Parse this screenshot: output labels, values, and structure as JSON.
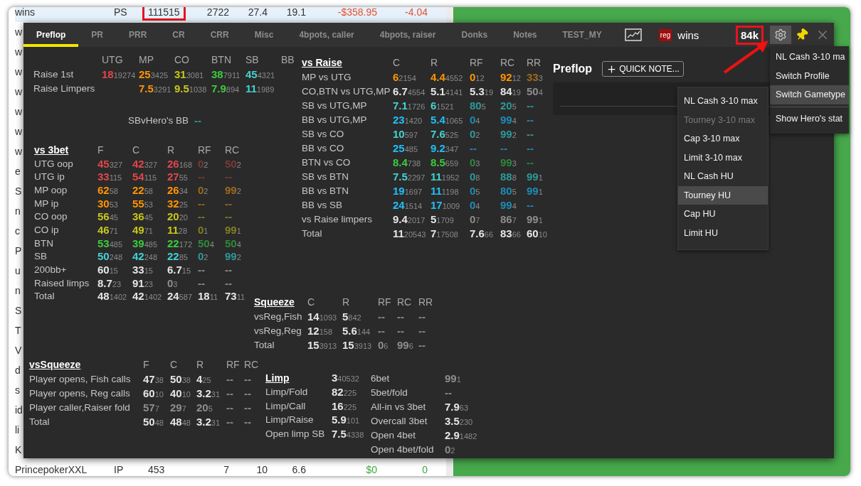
{
  "background_table": {
    "rows": [
      {
        "selected": true,
        "color": "#e8502e",
        "cells": [
          {
            "text": "wins",
            "boxed": false
          },
          {
            "text": "PS",
            "boxed": false
          },
          {
            "text": "111515",
            "boxed": true
          },
          {
            "text": "2722",
            "boxed": false
          },
          {
            "text": "27.4",
            "boxed": false
          },
          {
            "text": "19.1",
            "boxed": false
          },
          {
            "text": "-$358.95",
            "boxed": false
          },
          {
            "text": "-4.04",
            "boxed": false
          }
        ]
      },
      {
        "selected": false,
        "cells": [
          {
            "text": "w",
            "boxed": false
          }
        ]
      },
      {
        "selected": false,
        "cells": [
          {
            "text": "w",
            "boxed": false
          }
        ]
      },
      {
        "selected": false,
        "cells": [
          {
            "text": "w",
            "boxed": false
          }
        ]
      },
      {
        "selected": false,
        "cells": [
          {
            "text": "w",
            "boxed": false
          }
        ]
      },
      {
        "selected": false,
        "cells": [
          {
            "text": "w",
            "boxed": false
          }
        ]
      },
      {
        "selected": false,
        "cells": [
          {
            "text": "w",
            "boxed": false
          }
        ]
      },
      {
        "selected": false,
        "cells": [
          {
            "text": "w",
            "boxed": false
          }
        ]
      },
      {
        "selected": false,
        "cells": [
          {
            "text": "e",
            "boxed": false
          }
        ]
      },
      {
        "selected": false,
        "cells": [
          {
            "text": "S",
            "boxed": false
          }
        ]
      },
      {
        "selected": false,
        "cells": [
          {
            "text": "n",
            "boxed": false
          }
        ]
      },
      {
        "selected": false,
        "cells": [
          {
            "text": "c",
            "boxed": false
          }
        ]
      },
      {
        "selected": false,
        "cells": [
          {
            "text": "P",
            "boxed": false
          }
        ]
      },
      {
        "selected": false,
        "cells": [
          {
            "text": "u",
            "boxed": false
          }
        ]
      },
      {
        "selected": false,
        "cells": [
          {
            "text": "n",
            "boxed": false
          }
        ]
      },
      {
        "selected": false,
        "cells": [
          {
            "text": "S",
            "boxed": false
          }
        ]
      },
      {
        "selected": false,
        "cells": [
          {
            "text": "T",
            "boxed": false
          }
        ]
      },
      {
        "selected": false,
        "cells": [
          {
            "text": "V",
            "boxed": false
          }
        ]
      },
      {
        "selected": false,
        "cells": [
          {
            "text": "d",
            "boxed": false
          }
        ]
      },
      {
        "selected": false,
        "cells": [
          {
            "text": "s",
            "boxed": false
          }
        ]
      },
      {
        "selected": false,
        "cells": [
          {
            "text": "id",
            "boxed": false
          }
        ]
      },
      {
        "selected": false,
        "cells": [
          {
            "text": "li",
            "boxed": false
          }
        ]
      },
      {
        "selected": false,
        "cells": [
          {
            "text": "K",
            "boxed": false
          }
        ]
      },
      {
        "selected": false,
        "color": "#3caa3c",
        "cells": [
          {
            "text": "PrincepokerXXL",
            "boxed": false
          },
          {
            "text": "IP",
            "boxed": false
          },
          {
            "text": "453",
            "boxed": false
          },
          {
            "text": "7",
            "boxed": false
          },
          {
            "text": "10",
            "boxed": false
          },
          {
            "text": "6.6",
            "boxed": false
          },
          {
            "text": "$0",
            "boxed": false
          },
          {
            "text": "0",
            "boxed": false
          }
        ]
      }
    ]
  },
  "popup": {
    "tabs": [
      {
        "label": "Preflop",
        "selected": true
      },
      {
        "label": "PR",
        "selected": false
      },
      {
        "label": "PRR",
        "selected": false
      },
      {
        "label": "CR",
        "selected": false
      },
      {
        "label": "CRR",
        "selected": false
      },
      {
        "label": "Misc",
        "selected": false
      },
      {
        "label": "4bpots, caller",
        "selected": false
      },
      {
        "label": "4bpots, raiser",
        "selected": false
      },
      {
        "label": "Donks",
        "selected": false
      },
      {
        "label": "Notes",
        "selected": false
      },
      {
        "label": "TEST_MY",
        "selected": false
      }
    ],
    "player": {
      "type_badge": "reg",
      "name": "wins",
      "hands": "84k",
      "hands_boxed": true
    },
    "stats": {
      "positions": {
        "columns": [
          "UTG",
          "MP",
          "CO",
          "BTN",
          "SB",
          "BB"
        ],
        "rows": [
          {
            "label": "Raise 1st",
            "cells": [
              {
                "v": "18",
                "n": "19274",
                "color": "#e0474c"
              },
              {
                "v": "25",
                "n": "3425",
                "color": "#ff9500"
              },
              {
                "v": "31",
                "n": "3081",
                "color": "#c8c81a"
              },
              {
                "v": "38",
                "n": "7911",
                "color": "#3ccc3c"
              },
              {
                "v": "45",
                "n": "4321",
                "color": "#45d2d2"
              },
              null
            ]
          },
          {
            "label": "Raise Limpers",
            "cells": [
              null,
              {
                "v": "7.5",
                "n": "3291",
                "color": "#ff9500"
              },
              {
                "v": "9.5",
                "n": "1038",
                "color": "#c8c81a"
              },
              {
                "v": "7.9",
                "n": "894",
                "color": "#3ccc3c"
              },
              {
                "v": "11",
                "n": "1989",
                "color": "#45d2d2"
              },
              null
            ]
          }
        ]
      },
      "sb_vs_hero": {
        "label": "SBvHero's BB",
        "value": {
          "v": "--",
          "color": "#2e9a9a"
        }
      },
      "vs_3bet": {
        "title": "vs 3bet",
        "columns": [
          "F",
          "C",
          "R",
          "RF",
          "RC"
        ],
        "rows": [
          {
            "label": "UTG oop",
            "cells": [
              {
                "v": "45",
                "n": "327",
                "color": "#e0474c"
              },
              {
                "v": "42",
                "n": "327",
                "color": "#e0474c"
              },
              {
                "v": "26",
                "n": "168",
                "color": "#e0474c"
              },
              {
                "v": "0",
                "n": "2",
                "color": "#7a3a3a"
              },
              {
                "v": "50",
                "n": "2",
                "color": "#7a3a3a"
              }
            ]
          },
          {
            "label": "UTG ip",
            "cells": [
              {
                "v": "33",
                "n": "115",
                "color": "#e0474c"
              },
              {
                "v": "54",
                "n": "115",
                "color": "#e0474c"
              },
              {
                "v": "27",
                "n": "55",
                "color": "#e0474c"
              },
              {
                "v": "--",
                "color": "#7a3a3a"
              },
              {
                "v": "--",
                "color": "#7a3a3a"
              }
            ]
          },
          {
            "label": "MP oop",
            "cells": [
              {
                "v": "62",
                "n": "58",
                "color": "#ff9500"
              },
              {
                "v": "22",
                "n": "58",
                "color": "#ff9500"
              },
              {
                "v": "26",
                "n": "34",
                "color": "#ff9500"
              },
              {
                "v": "0",
                "n": "2",
                "color": "#a0691c"
              },
              {
                "v": "99",
                "n": "2",
                "color": "#a0691c"
              }
            ]
          },
          {
            "label": "MP ip",
            "cells": [
              {
                "v": "30",
                "n": "53",
                "color": "#ff9500"
              },
              {
                "v": "55",
                "n": "53",
                "color": "#ff9500"
              },
              {
                "v": "32",
                "n": "25",
                "color": "#ff9500"
              },
              {
                "v": "--",
                "color": "#a0691c"
              },
              {
                "v": "--",
                "color": "#a0691c"
              }
            ]
          },
          {
            "label": "CO oop",
            "cells": [
              {
                "v": "56",
                "n": "45",
                "color": "#c8c81a"
              },
              {
                "v": "36",
                "n": "45",
                "color": "#c8c81a"
              },
              {
                "v": "20",
                "n": "20",
                "color": "#c8c81a"
              },
              {
                "v": "--",
                "color": "#80801c"
              },
              {
                "v": "--",
                "color": "#80801c"
              }
            ]
          },
          {
            "label": "CO ip",
            "cells": [
              {
                "v": "46",
                "n": "71",
                "color": "#c8c81a"
              },
              {
                "v": "49",
                "n": "71",
                "color": "#c8c81a"
              },
              {
                "v": "11",
                "n": "28",
                "color": "#c8c81a"
              },
              {
                "v": "0",
                "n": "1",
                "color": "#80801c"
              },
              {
                "v": "99",
                "n": "1",
                "color": "#80801c"
              }
            ]
          },
          {
            "label": "BTN",
            "cells": [
              {
                "v": "53",
                "n": "485",
                "color": "#3ccc3c"
              },
              {
                "v": "39",
                "n": "485",
                "color": "#3ccc3c"
              },
              {
                "v": "22",
                "n": "172",
                "color": "#3ccc3c"
              },
              {
                "v": "50",
                "n": "4",
                "color": "#2e8a3a"
              },
              {
                "v": "50",
                "n": "4",
                "color": "#2e8a3a"
              }
            ]
          },
          {
            "label": "SB",
            "cells": [
              {
                "v": "50",
                "n": "248",
                "color": "#45d2d2"
              },
              {
                "v": "42",
                "n": "248",
                "color": "#45d2d2"
              },
              {
                "v": "22",
                "n": "85",
                "color": "#45d2d2"
              },
              {
                "v": "0",
                "n": "2",
                "color": "#2e9a9a"
              },
              {
                "v": "99",
                "n": "2",
                "color": "#2e9a9a"
              }
            ]
          },
          {
            "label": "200bb+",
            "cells": [
              {
                "v": "60",
                "n": "15",
                "color": "#e6e6e6"
              },
              {
                "v": "33",
                "n": "15",
                "color": "#e6e6e6"
              },
              {
                "v": "6.7",
                "n": "15",
                "color": "#e6e6e6"
              },
              {
                "v": "--",
                "color": "#8e8e8e"
              },
              {
                "v": "--",
                "color": "#8e8e8e"
              }
            ]
          },
          {
            "label": "Raised limps",
            "cells": [
              {
                "v": "8.7",
                "n": "23",
                "color": "#e6e6e6"
              },
              {
                "v": "91",
                "n": "23",
                "color": "#e6e6e6"
              },
              {
                "v": "0",
                "n": "3",
                "color": "#8e8e8e"
              },
              {
                "v": "--",
                "color": "#8e8e8e"
              },
              {
                "v": "--",
                "color": "#8e8e8e"
              }
            ]
          },
          {
            "label": "Total",
            "cells": [
              {
                "v": "48",
                "n": "1402",
                "color": "#e6e6e6"
              },
              {
                "v": "42",
                "n": "1402",
                "color": "#e6e6e6"
              },
              {
                "v": "24",
                "n": "587",
                "color": "#e6e6e6"
              },
              {
                "v": "18",
                "n": "11",
                "color": "#e6e6e6"
              },
              {
                "v": "73",
                "n": "11",
                "color": "#e6e6e6"
              }
            ]
          }
        ]
      },
      "vs_raise": {
        "title": "vs Raise",
        "columns": [
          "C",
          "R",
          "RF",
          "RC",
          "RR"
        ],
        "rows": [
          {
            "label": "MP vs UTG",
            "cells": [
              {
                "v": "6",
                "n": "2154",
                "color": "#ff9500"
              },
              {
                "v": "4.4",
                "n": "4552",
                "color": "#ff9500"
              },
              {
                "v": "0",
                "n": "12",
                "color": "#ff9500"
              },
              {
                "v": "92",
                "n": "12",
                "color": "#ff9500"
              },
              {
                "v": "33",
                "n": "3",
                "color": "#a0691c"
              }
            ]
          },
          {
            "label": "CO,BTN vs UTG,MP",
            "cells": [
              {
                "v": "6.7",
                "n": "4554",
                "color": "#e6e6e6"
              },
              {
                "v": "5.1",
                "n": "4141",
                "color": "#e6e6e6"
              },
              {
                "v": "5.3",
                "n": "19",
                "color": "#e6e6e6"
              },
              {
                "v": "84",
                "n": "19",
                "color": "#e6e6e6"
              },
              {
                "v": "50",
                "n": "4",
                "color": "#8e8e8e"
              }
            ]
          },
          {
            "label": "SB vs UTG,MP",
            "cells": [
              {
                "v": "7.1",
                "n": "1726",
                "color": "#45d2d2"
              },
              {
                "v": "6",
                "n": "1521",
                "color": "#45d2d2"
              },
              {
                "v": "80",
                "n": "5",
                "color": "#2e9a9a"
              },
              {
                "v": "20",
                "n": "5",
                "color": "#2e9a9a"
              },
              {
                "v": "--",
                "color": "#2e9a9a"
              }
            ]
          },
          {
            "label": "BB vs UTG,MP",
            "cells": [
              {
                "v": "23",
                "n": "1420",
                "color": "#20c0f8"
              },
              {
                "v": "5.4",
                "n": "1065",
                "color": "#20c0f8"
              },
              {
                "v": "0",
                "n": "4",
                "color": "#1e8cb8"
              },
              {
                "v": "99",
                "n": "4",
                "color": "#1e8cb8"
              },
              {
                "v": "--",
                "color": "#1e8cb8"
              }
            ]
          },
          {
            "label": "SB vs CO",
            "cells": [
              {
                "v": "10",
                "n": "597",
                "color": "#45d2d2"
              },
              {
                "v": "7.6",
                "n": "525",
                "color": "#45d2d2"
              },
              {
                "v": "0",
                "n": "2",
                "color": "#2e9a9a"
              },
              {
                "v": "99",
                "n": "2",
                "color": "#2e9a9a"
              },
              {
                "v": "--",
                "color": "#2e9a9a"
              }
            ]
          },
          {
            "label": "BB vs CO",
            "cells": [
              {
                "v": "25",
                "n": "485",
                "color": "#20c0f8"
              },
              {
                "v": "9.2",
                "n": "347",
                "color": "#20c0f8"
              },
              {
                "v": "--",
                "color": "#1e8cb8"
              },
              {
                "v": "--",
                "color": "#1e8cb8"
              },
              {
                "v": "--",
                "color": "#1e8cb8"
              }
            ]
          },
          {
            "label": "BTN vs CO",
            "cells": [
              {
                "v": "8.4",
                "n": "738",
                "color": "#3ccc3c"
              },
              {
                "v": "8.5",
                "n": "659",
                "color": "#3ccc3c"
              },
              {
                "v": "0",
                "n": "3",
                "color": "#2e8a3a"
              },
              {
                "v": "99",
                "n": "3",
                "color": "#2e8a3a"
              },
              {
                "v": "--",
                "color": "#2e8a3a"
              }
            ]
          },
          {
            "label": "SB vs BTN",
            "cells": [
              {
                "v": "7.5",
                "n": "2297",
                "color": "#45d2d2"
              },
              {
                "v": "11",
                "n": "1952",
                "color": "#45d2d2"
              },
              {
                "v": "0",
                "n": "8",
                "color": "#2e9a9a"
              },
              {
                "v": "88",
                "n": "8",
                "color": "#2e9a9a"
              },
              {
                "v": "99",
                "n": "1",
                "color": "#2e9a9a"
              }
            ]
          },
          {
            "label": "BB vs BTN",
            "cells": [
              {
                "v": "19",
                "n": "1697",
                "color": "#20c0f8"
              },
              {
                "v": "11",
                "n": "1198",
                "color": "#20c0f8"
              },
              {
                "v": "0",
                "n": "5",
                "color": "#1e8cb8"
              },
              {
                "v": "80",
                "n": "5",
                "color": "#1e8cb8"
              },
              {
                "v": "99",
                "n": "1",
                "color": "#1e8cb8"
              }
            ]
          },
          {
            "label": "BB vs SB",
            "cells": [
              {
                "v": "24",
                "n": "1514",
                "color": "#20c0f8"
              },
              {
                "v": "17",
                "n": "1009",
                "color": "#20c0f8"
              },
              {
                "v": "0",
                "n": "4",
                "color": "#1e8cb8"
              },
              {
                "v": "99",
                "n": "4",
                "color": "#1e8cb8"
              },
              {
                "v": "--",
                "color": "#1e8cb8"
              }
            ]
          },
          {
            "label": "vs Raise limpers",
            "cells": [
              {
                "v": "9.4",
                "n": "2017",
                "color": "#e6e6e6"
              },
              {
                "v": "5",
                "n": "1709",
                "color": "#e6e6e6"
              },
              {
                "v": "0",
                "n": "7",
                "color": "#8e8e8e"
              },
              {
                "v": "86",
                "n": "7",
                "color": "#8e8e8e"
              },
              {
                "v": "99",
                "n": "1",
                "color": "#8e8e8e"
              }
            ]
          },
          {
            "label": "Total",
            "cells": [
              {
                "v": "11",
                "n": "20543",
                "color": "#e6e6e6"
              },
              {
                "v": "7",
                "n": "17508",
                "color": "#e6e6e6"
              },
              {
                "v": "7.6",
                "n": "66",
                "color": "#e6e6e6"
              },
              {
                "v": "83",
                "n": "66",
                "color": "#e6e6e6"
              },
              {
                "v": "60",
                "n": "10",
                "color": "#e6e6e6"
              }
            ]
          }
        ]
      },
      "squeeze": {
        "title": "Squeeze",
        "columns": [
          "C",
          "R",
          "RF",
          "RC",
          "RR"
        ],
        "rows": [
          {
            "label": "vsReg,Fish",
            "cells": [
              {
                "v": "14",
                "n": "1093",
                "color": "#e6e6e6"
              },
              {
                "v": "5",
                "n": "842",
                "color": "#e6e6e6"
              },
              {
                "v": "--",
                "color": "#8e8e8e"
              },
              {
                "v": "--",
                "color": "#8e8e8e"
              },
              {
                "v": "--",
                "color": "#8e8e8e"
              }
            ]
          },
          {
            "label": "vsReg,Reg",
            "cells": [
              {
                "v": "12",
                "n": "158",
                "color": "#e6e6e6"
              },
              {
                "v": "5.6",
                "n": "144",
                "color": "#e6e6e6"
              },
              {
                "v": "--",
                "color": "#8e8e8e"
              },
              {
                "v": "--",
                "color": "#8e8e8e"
              },
              {
                "v": "--",
                "color": "#8e8e8e"
              }
            ]
          },
          {
            "label": "Total",
            "cells": [
              {
                "v": "15",
                "n": "3913",
                "color": "#e6e6e6"
              },
              {
                "v": "15",
                "n": "3913",
                "color": "#e6e6e6"
              },
              {
                "v": "0",
                "n": "6",
                "color": "#8e8e8e"
              },
              {
                "v": "99",
                "n": "6",
                "color": "#8e8e8e"
              },
              {
                "v": "--",
                "color": "#8e8e8e"
              }
            ]
          }
        ]
      },
      "vs_squeeze": {
        "title": "vsSqueeze",
        "columns": [
          "F",
          "C",
          "R",
          "RF",
          "RC"
        ],
        "rows": [
          {
            "label": "Player opens, Fish calls",
            "cells": [
              {
                "v": "47",
                "n": "38",
                "color": "#e6e6e6"
              },
              {
                "v": "50",
                "n": "38",
                "color": "#e6e6e6"
              },
              {
                "v": "4",
                "n": "25",
                "color": "#e6e6e6"
              },
              {
                "v": "--",
                "color": "#8e8e8e"
              },
              {
                "v": "--",
                "color": "#8e8e8e"
              }
            ]
          },
          {
            "label": "Player opens, Reg calls",
            "cells": [
              {
                "v": "60",
                "n": "10",
                "color": "#e6e6e6"
              },
              {
                "v": "40",
                "n": "10",
                "color": "#e6e6e6"
              },
              {
                "v": "3.2",
                "n": "31",
                "color": "#e6e6e6"
              },
              {
                "v": "--",
                "color": "#8e8e8e"
              },
              {
                "v": "--",
                "color": "#8e8e8e"
              }
            ]
          },
          {
            "label": "Player caller,Raiser fold",
            "cells": [
              {
                "v": "57",
                "n": "7",
                "color": "#8e8e8e"
              },
              {
                "v": "29",
                "n": "7",
                "color": "#8e8e8e"
              },
              {
                "v": "20",
                "n": "5",
                "color": "#8e8e8e"
              },
              {
                "v": "--",
                "color": "#8e8e8e"
              },
              {
                "v": "--",
                "color": "#8e8e8e"
              }
            ]
          },
          {
            "label": "Total",
            "cells": [
              {
                "v": "50",
                "n": "48",
                "color": "#e6e6e6"
              },
              {
                "v": "48",
                "n": "48",
                "color": "#e6e6e6"
              },
              {
                "v": "3.2",
                "n": "31",
                "color": "#e6e6e6"
              },
              {
                "v": "--",
                "color": "#8e8e8e"
              },
              {
                "v": "--",
                "color": "#8e8e8e"
              }
            ]
          }
        ]
      },
      "limp": {
        "title": "Limp",
        "title_cell": {
          "v": "3",
          "n": "40532",
          "color": "#e6e6e6"
        },
        "rows": [
          {
            "label": "Limp/Fold",
            "cells": [
              {
                "v": "82",
                "n": "225",
                "color": "#e6e6e6"
              }
            ]
          },
          {
            "label": "Limp/Call",
            "cells": [
              {
                "v": "16",
                "n": "225",
                "color": "#e6e6e6"
              }
            ]
          },
          {
            "label": "Limp/Raise",
            "cells": [
              {
                "v": "5.9",
                "n": "101",
                "color": "#e6e6e6"
              }
            ]
          },
          {
            "label": "Open limp SB",
            "cells": [
              {
                "v": "7.5",
                "n": "4338",
                "color": "#e6e6e6"
              }
            ]
          }
        ]
      },
      "misc": {
        "rows": [
          {
            "label": "6bet",
            "cells": [
              {
                "v": "99",
                "n": "1",
                "color": "#8e8e8e"
              }
            ]
          },
          {
            "label": "5bet/fold",
            "cells": [
              {
                "v": "--",
                "color": "#8e8e8e"
              }
            ]
          },
          {
            "label": "All-in vs 3bet",
            "cells": [
              {
                "v": "7.9",
                "n": "63",
                "color": "#e6e6e6"
              }
            ]
          },
          {
            "label": "Overcall 3bet",
            "cells": [
              {
                "v": "3.5",
                "n": "230",
                "color": "#e6e6e6"
              }
            ]
          },
          {
            "label": "Open 4bet",
            "cells": [
              {
                "v": "2.9",
                "n": "1482",
                "color": "#e6e6e6"
              }
            ]
          },
          {
            "label": "Open 4bet/fold",
            "cells": [
              {
                "v": "0",
                "n": "2",
                "color": "#8e8e8e"
              }
            ]
          }
        ]
      }
    },
    "notes": {
      "title": "Preflop",
      "button": "QUICK NOTE..."
    }
  },
  "context_menu": {
    "items": [
      {
        "kind": "item",
        "label": "NL Cash 3-10 ma",
        "selected": false
      },
      {
        "kind": "item",
        "label": "Switch Profile",
        "selected": false
      },
      {
        "kind": "item",
        "label": "Switch Gametype",
        "selected": true
      },
      {
        "kind": "separator"
      },
      {
        "kind": "item",
        "label": "Show Hero's stat",
        "selected": false
      }
    ]
  },
  "submenu": {
    "items": [
      {
        "label": "NL Cash 3-10 max",
        "selected": false,
        "disabled": false
      },
      {
        "label": "Tourney 3-10 max",
        "selected": false,
        "disabled": true
      },
      {
        "label": "Cap 3-10 max",
        "selected": false,
        "disabled": false
      },
      {
        "label": "Limit 3-10 max",
        "selected": false,
        "disabled": false
      },
      {
        "label": "NL Cash HU",
        "selected": false,
        "disabled": false
      },
      {
        "label": "Tourney HU",
        "selected": true,
        "disabled": false
      },
      {
        "label": "Cap HU",
        "selected": false,
        "disabled": false
      },
      {
        "label": "Limit HU",
        "selected": false,
        "disabled": false
      }
    ]
  }
}
